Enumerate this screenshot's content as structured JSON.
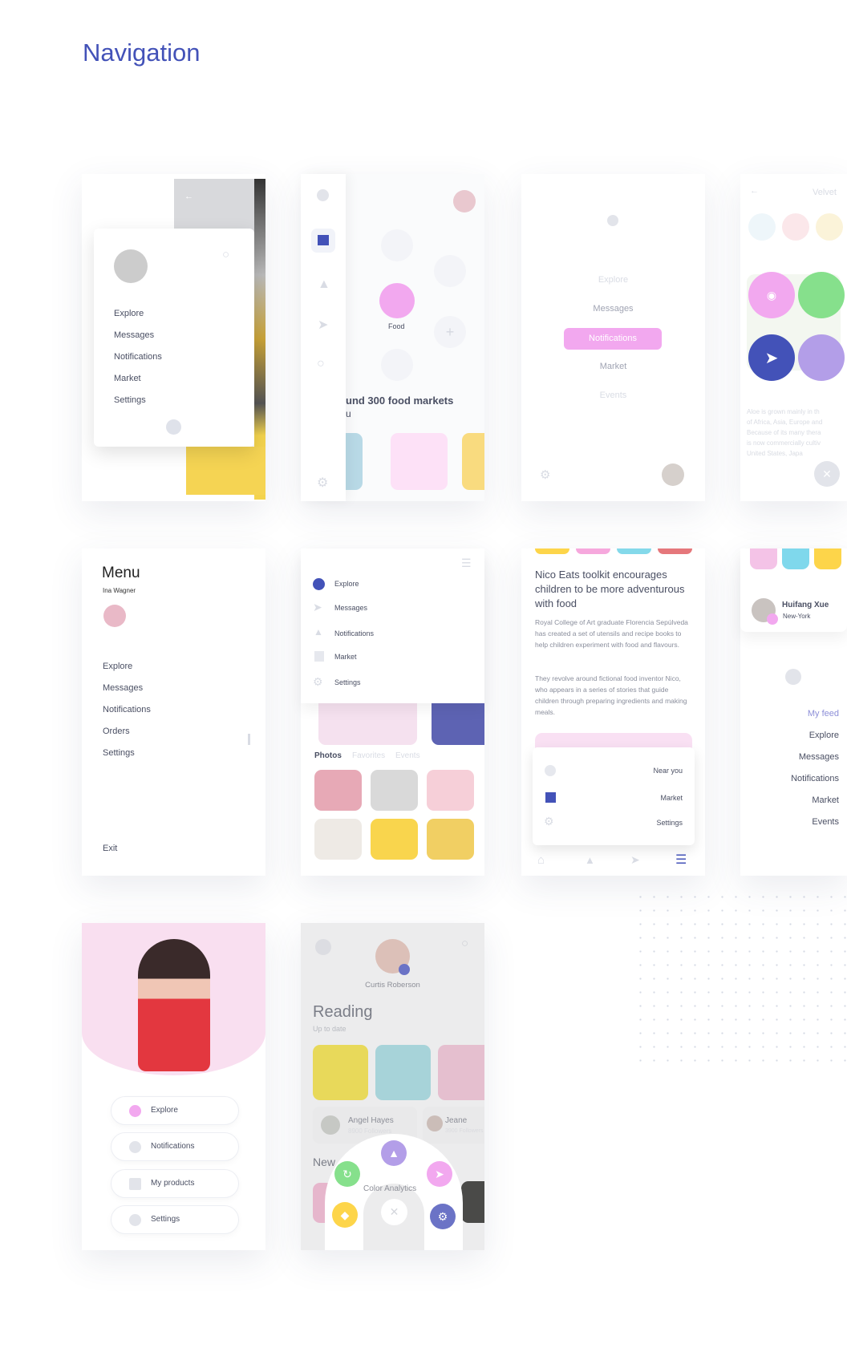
{
  "page": {
    "title": "Navigation",
    "accent": "#4352b8",
    "pink": "#f2a8ef",
    "green": "#86e08c",
    "purple": "#b39ee8",
    "yellow": "#fdd54a"
  },
  "p1": {
    "items": [
      "Explore",
      "Messages",
      "Notifications",
      "Market",
      "Settings"
    ],
    "icons": [
      "back-arrow-icon",
      "search-icon",
      "chevron-down-icon"
    ]
  },
  "p2": {
    "category": "Food",
    "headline": "und 300 food markets",
    "sub": "u",
    "sidebar_icons": [
      "close-icon",
      "home-icon",
      "bell-icon",
      "send-icon",
      "search-icon",
      "gear-icon"
    ]
  },
  "p3": {
    "items": [
      "Explore",
      "Messages",
      "Notifications",
      "Market",
      "Events"
    ],
    "active": "Notifications"
  },
  "p4": {
    "title": "Velvet",
    "body": [
      "Aloe is grown mainly in th",
      "of Africa, Asia, Europe and",
      "Because of its many thera",
      "is now commercially cultiv",
      "United States, Japa"
    ],
    "fab_icons": [
      "compass-icon",
      "send-icon"
    ]
  },
  "p5": {
    "title": "Menu",
    "user": "Ina Wagner",
    "items": [
      "Explore",
      "Messages",
      "Notifications",
      "Orders",
      "Settings"
    ],
    "exit": "Exit"
  },
  "p6": {
    "items": [
      "Explore",
      "Messages",
      "Notifications",
      "Market",
      "Settings"
    ],
    "tabs": [
      "Photos",
      "Favorites",
      "Events"
    ]
  },
  "p7": {
    "headline": "Nico Eats toolkit encourages children to be more adventurous with food",
    "para1": "Royal College of Art graduate Florencia Sepúlveda has created a set of utensils and recipe books to help children experiment with food and flavours.",
    "para2": "They revolve around fictional food inventor Nico, who appears in a series of stories that guide children through preparing ingredients and making meals.",
    "menu": [
      "Near you",
      "Market",
      "Settings"
    ]
  },
  "p8": {
    "name": "Huifang Xue",
    "location": "New-York",
    "items": [
      "My feed",
      "Explore",
      "Messages",
      "Notifications",
      "Market",
      "Events"
    ]
  },
  "p9": {
    "items": [
      "Explore",
      "Notifications",
      "My products",
      "Settings"
    ]
  },
  "p10": {
    "user": "Curtis Roberson",
    "section": "Reading",
    "section_sub": "Up to date",
    "people": [
      {
        "name": "Angel Hayes",
        "followers": "8900 Followers"
      },
      {
        "name": "Jeane",
        "followers": "3900 Followers"
      }
    ],
    "new_label": "New",
    "article": "Color Analytics"
  }
}
